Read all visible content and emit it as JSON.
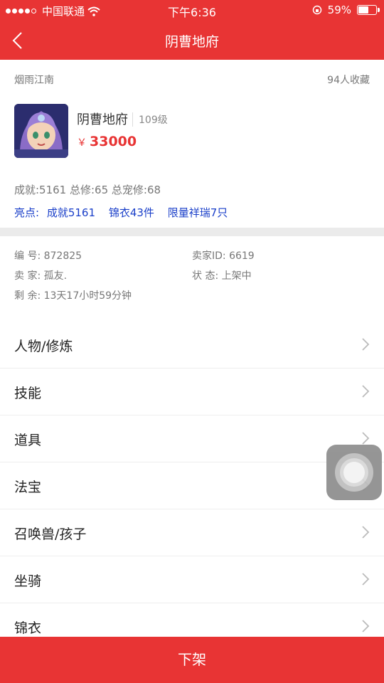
{
  "status_bar": {
    "carrier": "中国联通",
    "time": "下午6:36",
    "battery": "59%"
  },
  "nav": {
    "title": "阴曹地府"
  },
  "info": {
    "server": "烟雨江南",
    "favorites": "94人收藏",
    "name": "阴曹地府",
    "level": "109级",
    "currency": "￥",
    "price": "33000",
    "stats": "成就:5161  总修:65  总宠修:68",
    "highlights_label": "亮点:",
    "highlights": [
      "成就5161",
      "锦衣43件",
      "限量祥瑞7只"
    ]
  },
  "meta": {
    "id": "编  号: 872825",
    "seller_id": "卖家ID: 6619",
    "seller": "卖  家: 孤友.",
    "status": "状  态: 上架中",
    "remaining": "剩  余: 13天17小时59分钟"
  },
  "menu": [
    {
      "label": "人物/修炼"
    },
    {
      "label": "技能"
    },
    {
      "label": "道具"
    },
    {
      "label": "法宝"
    },
    {
      "label": "召唤兽/孩子"
    },
    {
      "label": "坐骑"
    },
    {
      "label": "锦衣"
    }
  ],
  "bottom": {
    "button": "下架"
  },
  "colors": {
    "accent": "#e83434",
    "link": "#1a3fc9"
  }
}
